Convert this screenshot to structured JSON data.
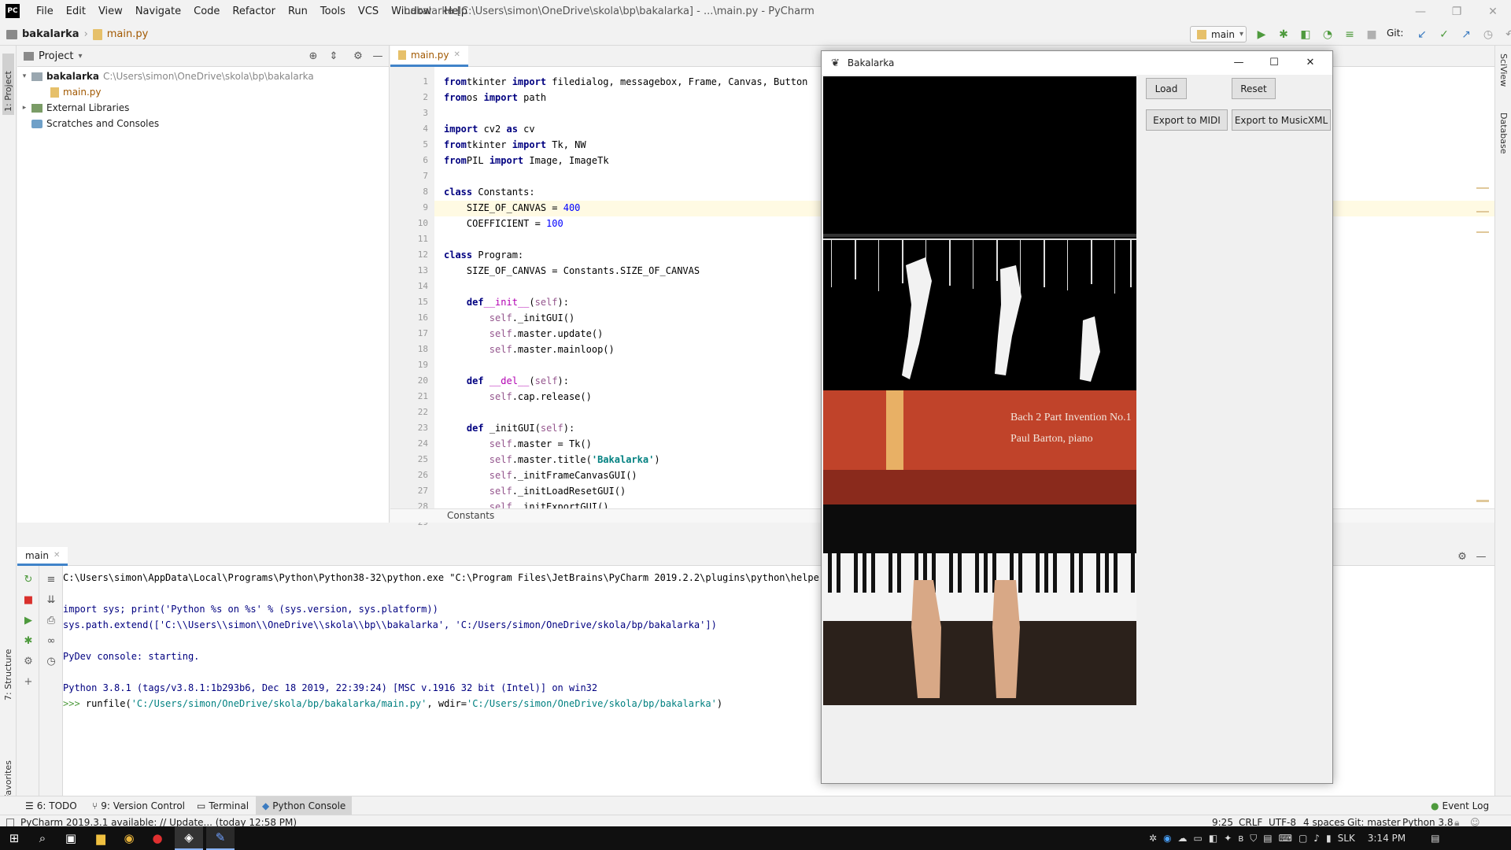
{
  "titlebar": {
    "app_icon": "PC",
    "menu": [
      "File",
      "Edit",
      "View",
      "Navigate",
      "Code",
      "Refactor",
      "Run",
      "Tools",
      "VCS",
      "Window",
      "Help"
    ],
    "title": "bakalarka [C:\\Users\\simon\\OneDrive\\skola\\bp\\bakalarka] - ...\\main.py - PyCharm"
  },
  "navbar": {
    "project": "bakalarka",
    "file": "main.py",
    "run_config": "main",
    "git_label": "Git:"
  },
  "left_stripe": {
    "project": "1: Project",
    "structure": "7: Structure",
    "favorites": "2: Favorites"
  },
  "right_stripe": {
    "sciview": "SciView",
    "database": "Database"
  },
  "project_panel": {
    "header": "Project",
    "tree": [
      {
        "label": "bakalarka",
        "path": "C:\\Users\\simon\\OneDrive\\skola\\bp\\bakalarka"
      },
      {
        "label": "main.py"
      },
      {
        "label": "External Libraries"
      },
      {
        "label": "Scratches and Consoles"
      }
    ]
  },
  "editor": {
    "tab": "main.py",
    "breadcrumb": "Constants",
    "highlight_line": 9,
    "lines": [
      [
        [
          "kw",
          "from"
        ],
        [
          "",
          "tkinter "
        ],
        [
          "kw",
          "import"
        ],
        [
          "",
          " filedialog, messagebox, Frame, Canvas, Button"
        ]
      ],
      [
        [
          "kw",
          "from"
        ],
        [
          "",
          "os "
        ],
        [
          "kw",
          "import"
        ],
        [
          "",
          " path"
        ]
      ],
      [],
      [
        [
          "kw",
          "import"
        ],
        [
          "",
          " cv2 "
        ],
        [
          "kw",
          "as"
        ],
        [
          "",
          " cv"
        ]
      ],
      [
        [
          "kw",
          "from"
        ],
        [
          "",
          "tkinter "
        ],
        [
          "kw",
          "import"
        ],
        [
          "",
          " Tk, NW"
        ]
      ],
      [
        [
          "kw",
          "from"
        ],
        [
          "",
          "PIL "
        ],
        [
          "kw",
          "import"
        ],
        [
          "",
          " Image, ImageTk"
        ]
      ],
      [],
      [
        [
          "kw",
          "class"
        ],
        [
          "",
          " Constants:"
        ]
      ],
      [
        [
          "",
          "    SIZE_OF_CANVAS = "
        ],
        [
          "num",
          "400"
        ]
      ],
      [
        [
          "",
          "    COEFFICIENT = "
        ],
        [
          "num",
          "100"
        ]
      ],
      [],
      [
        [
          "kw",
          "class"
        ],
        [
          "",
          " Program:"
        ]
      ],
      [
        [
          "",
          "    SIZE_OF_CANVAS = Constants.SIZE_OF_CANVAS"
        ]
      ],
      [],
      [
        [
          "",
          "    "
        ],
        [
          "kw",
          "def"
        ],
        [
          "",
          "",
          " "
        ],
        [
          "fn",
          "__init__"
        ],
        [
          "",
          "("
        ],
        [
          "self",
          "self"
        ],
        [
          "",
          "):"
        ]
      ],
      [
        [
          "",
          "        "
        ],
        [
          "self",
          "self"
        ],
        [
          "",
          "._initGUI()"
        ]
      ],
      [
        [
          "",
          "        "
        ],
        [
          "self",
          "self"
        ],
        [
          "",
          ".master.update()"
        ]
      ],
      [
        [
          "",
          "        "
        ],
        [
          "self",
          "self"
        ],
        [
          "",
          ".master.mainloop()"
        ]
      ],
      [],
      [
        [
          "",
          "    "
        ],
        [
          "kw",
          "def"
        ],
        [
          "",
          " "
        ],
        [
          "fn",
          "__del__"
        ],
        [
          "",
          "("
        ],
        [
          "self",
          "self"
        ],
        [
          "",
          "):"
        ]
      ],
      [
        [
          "",
          "        "
        ],
        [
          "self",
          "self"
        ],
        [
          "",
          ".cap.release()"
        ]
      ],
      [],
      [
        [
          "",
          "    "
        ],
        [
          "kw",
          "def"
        ],
        [
          "",
          " _initGUI("
        ],
        [
          "self",
          "self"
        ],
        [
          "",
          "):"
        ]
      ],
      [
        [
          "",
          "        "
        ],
        [
          "self",
          "self"
        ],
        [
          "",
          ".master = Tk()"
        ]
      ],
      [
        [
          "",
          "        "
        ],
        [
          "self",
          "self"
        ],
        [
          "",
          ".master.title("
        ],
        [
          "str",
          "'Bakalarka'"
        ],
        [
          "",
          ")"
        ]
      ],
      [
        [
          "",
          "        "
        ],
        [
          "self",
          "self"
        ],
        [
          "",
          "._initFrameCanvasGUI()"
        ]
      ],
      [
        [
          "",
          "        "
        ],
        [
          "self",
          "self"
        ],
        [
          "",
          "._initLoadResetGUI()"
        ]
      ],
      [
        [
          "",
          "        "
        ],
        [
          "self",
          "self"
        ],
        [
          "",
          "._initExportGUI()"
        ]
      ],
      []
    ]
  },
  "console": {
    "tab": "main",
    "lines": [
      "C:\\Users\\simon\\AppData\\Local\\Programs\\Python\\Python38-32\\python.exe \"C:\\Program Files\\JetBrains\\PyCharm 2019.2.2\\plugins\\python\\helpers\\py",
      "",
      "import sys; print('Python %s on %s' % (sys.version, sys.platform))",
      "sys.path.extend(['C:\\\\Users\\\\simon\\\\OneDrive\\\\skola\\\\bp\\\\bakalarka', 'C:/Users/simon/OneDrive/skola/bp/bakalarka'])",
      "",
      "PyDev console: starting.",
      "",
      "Python 3.8.1 (tags/v3.8.1:1b293b6, Dec 18 2019, 22:39:24) [MSC v.1916 32 bit (Intel)] on win32"
    ],
    "prompt": ">>> ",
    "runfile_a": "runfile(",
    "runfile_path": "'C:/Users/simon/OneDrive/skola/bp/bakalarka/main.py'",
    "runfile_b": ", wdir=",
    "runfile_wdir": "'C:/Users/simon/OneDrive/skola/bp/bakalarka'",
    "runfile_c": ")"
  },
  "tool_tabs": {
    "todo": "6: TODO",
    "vcs": "9: Version Control",
    "terminal": "Terminal",
    "pyconsole": "Python Console",
    "event_log": "Event Log"
  },
  "status": {
    "message": "PyCharm 2019.3.1 available: // Update... (today 12:58 PM)",
    "position": "9:25",
    "line_sep": "CRLF",
    "encoding": "UTF-8",
    "indent": "4 spaces",
    "git": "Git: master",
    "python": "Python 3.8"
  },
  "tk_window": {
    "title": "Bakalarka",
    "load": "Load",
    "reset": "Reset",
    "export_midi": "Export to MIDI",
    "export_musicxml": "Export to MusicXML",
    "video_text_1": "Bach 2 Part Invention No.1",
    "video_text_2": "Paul Barton, piano"
  },
  "taskbar": {
    "tray_lang": "SLK",
    "time": "3:14 PM"
  }
}
